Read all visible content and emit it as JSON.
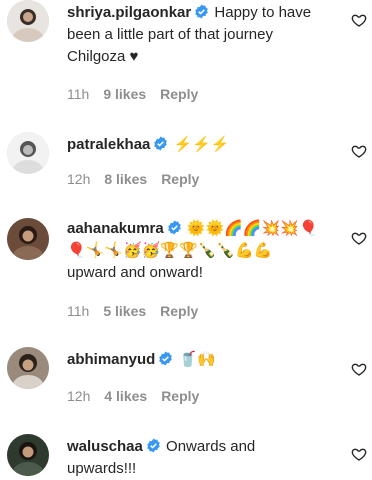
{
  "colors": {
    "verified": "#3897f0",
    "meta": "#8e8e8e",
    "text": "#262626"
  },
  "comments": [
    {
      "username": "shriya.pilgaonkar",
      "text": "Happy to have been a little part of that journey Chilgoza ♥",
      "emoji": "",
      "time": "11h",
      "likes": "9 likes",
      "reply": "Reply"
    },
    {
      "username": "patralekhaa",
      "text": "",
      "emoji": "⚡⚡⚡",
      "time": "12h",
      "likes": "8 likes",
      "reply": "Reply"
    },
    {
      "username": "aahanakumra",
      "emoji": "🌞🌞🌈🌈💥💥🎈🎈🤸🤸🥳🥳🏆🏆🍾🍾💪💪",
      "text": "upward and onward!",
      "time": "11h",
      "likes": "5 likes",
      "reply": "Reply"
    },
    {
      "username": "abhimanyud",
      "text": "",
      "emoji": "🥤🙌",
      "time": "12h",
      "likes": "4 likes",
      "reply": "Reply"
    },
    {
      "username": "waluschaa",
      "text": "Onwards and upwards!!!",
      "emoji": "",
      "time": "",
      "likes": "",
      "reply": ""
    }
  ]
}
